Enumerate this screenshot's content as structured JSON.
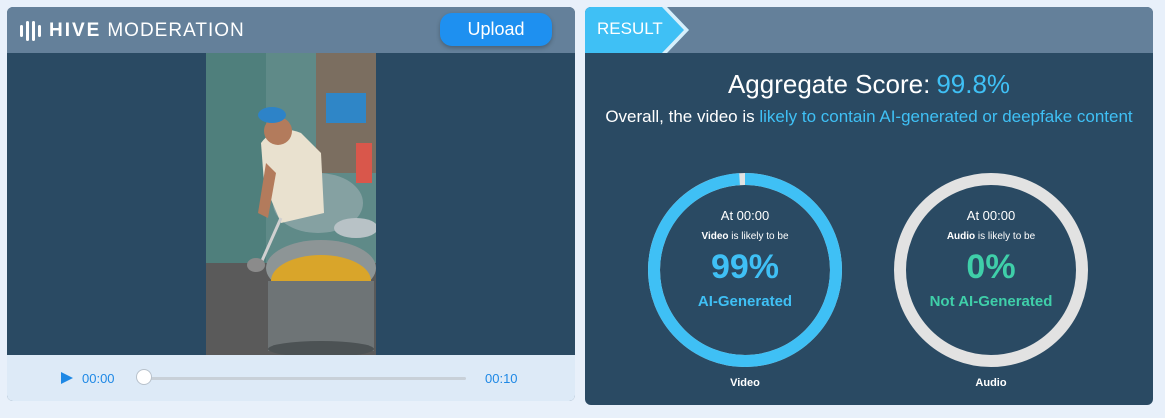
{
  "app": {
    "logo_bold": "HIVE",
    "logo_light": "MODERATION",
    "upload_label": "Upload"
  },
  "player": {
    "current_time": "00:00",
    "duration": "00:10",
    "progress": 0
  },
  "result": {
    "tab_label": "RESULT",
    "aggregate_label": "Aggregate Score:",
    "aggregate_value": "99.8%",
    "summary_prefix": "Overall, the video is ",
    "summary_highlight": "likely to contain AI-generated or deepfake content",
    "video_gauge": {
      "at": "At 00:00",
      "subject": "Video",
      "likely": " is likely to be",
      "percent": "99%",
      "fraction": 0.99,
      "label": "AI-Generated",
      "caption": "Video",
      "color": "#3fc0f5"
    },
    "audio_gauge": {
      "at": "At 00:00",
      "subject": "Audio",
      "likely": " is likely to be",
      "percent": "0%",
      "fraction": 0,
      "label": "Not AI-Generated",
      "caption": "Audio",
      "color": "#3fcfa9"
    }
  },
  "colors": {
    "panel": "#2a4a63",
    "header": "#64809a",
    "accent_blue": "#3fc0f5",
    "accent_green": "#3fcfa9",
    "ring_track": "#e2e2e2",
    "upload_button": "#1e90f0"
  }
}
